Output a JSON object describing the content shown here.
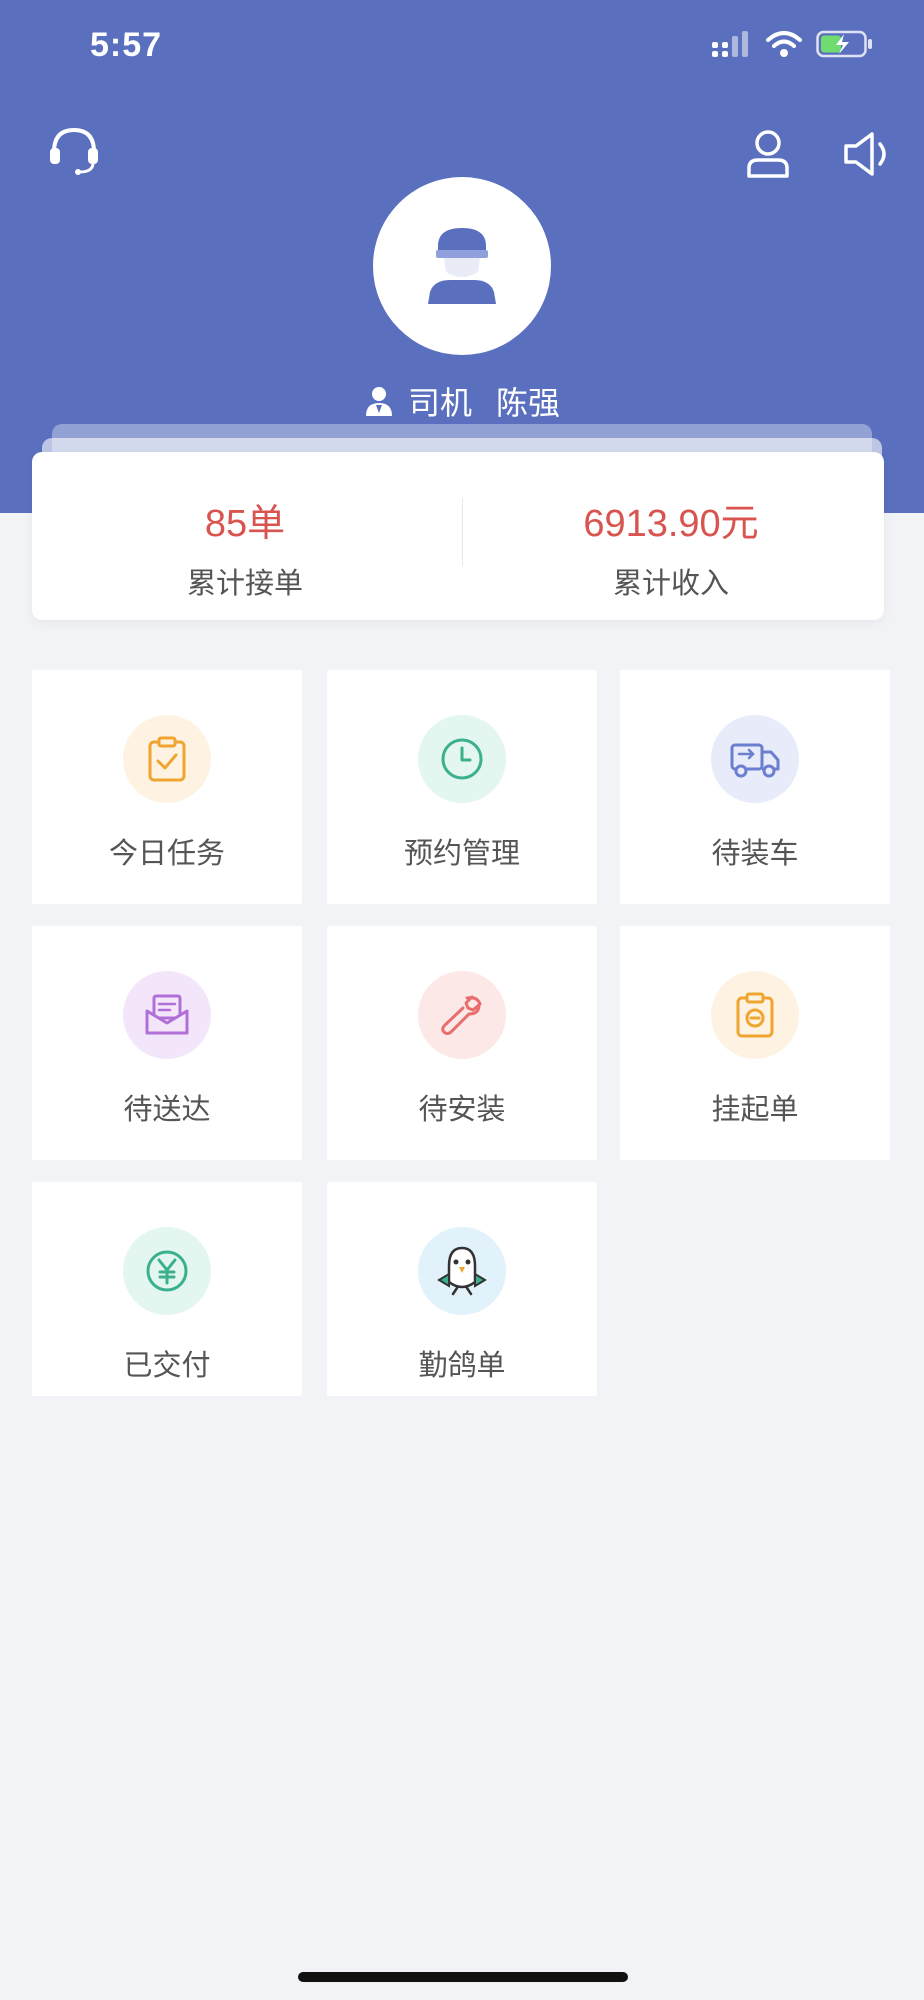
{
  "status_bar": {
    "time": "5:57"
  },
  "header": {
    "role": "司机",
    "name": "陈强"
  },
  "stats": [
    {
      "value": "85单",
      "label": "累计接单"
    },
    {
      "value": "6913.90元",
      "label": "累计收入"
    }
  ],
  "tiles": [
    {
      "label": "今日任务",
      "icon": "clipboard-check-icon",
      "color": "#f0a530",
      "bg": "#fef3e2"
    },
    {
      "label": "预约管理",
      "icon": "clock-icon",
      "color": "#3bb08f",
      "bg": "#e3f6ef"
    },
    {
      "label": "待装车",
      "icon": "truck-icon",
      "color": "#6b7fd0",
      "bg": "#e8ebf9"
    },
    {
      "label": "待送达",
      "icon": "envelope-icon",
      "color": "#b070d8",
      "bg": "#f3e6fb"
    },
    {
      "label": "待安装",
      "icon": "wrench-icon",
      "color": "#e86d6d",
      "bg": "#fde8e8"
    },
    {
      "label": "挂起单",
      "icon": "clipboard-minus-icon",
      "color": "#f0a530",
      "bg": "#fef3e2"
    },
    {
      "label": "已交付",
      "icon": "yen-icon",
      "color": "#3bb08f",
      "bg": "#e3f6ef"
    },
    {
      "label": "勤鸽单",
      "icon": "pigeon-icon",
      "color": "#3a8fd0",
      "bg": "#e2f2fb"
    }
  ],
  "colors": {
    "header_bg": "#5a70bf",
    "page_bg": "#f2f3f6",
    "stat_value": "#d9534f"
  }
}
